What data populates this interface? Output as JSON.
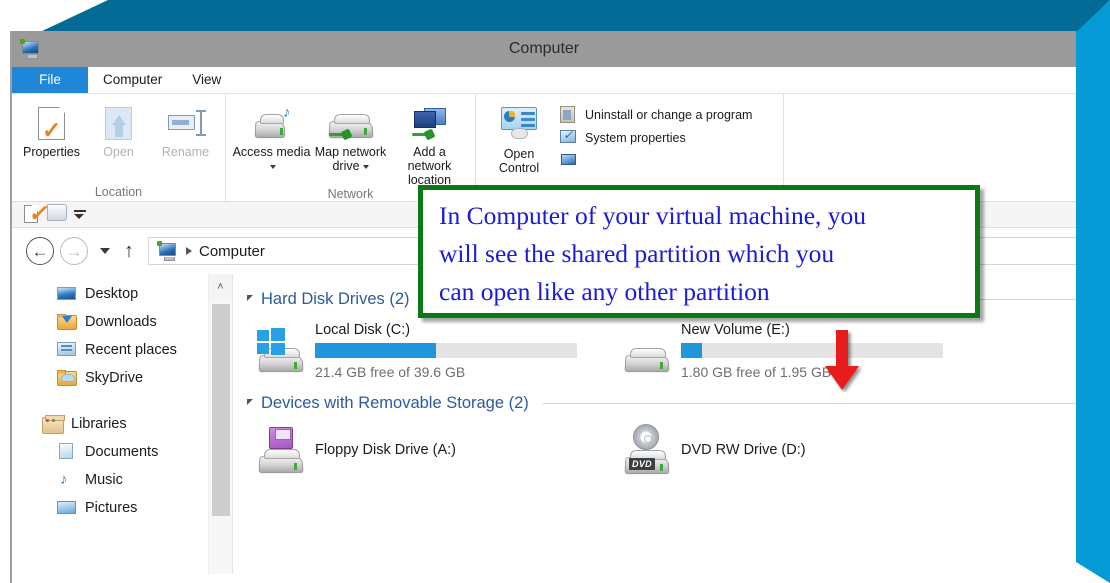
{
  "window": {
    "title": "Computer",
    "icon": "computer-icon"
  },
  "tabs": [
    {
      "label": "File",
      "type": "file"
    },
    {
      "label": "Computer",
      "type": "tab",
      "active": true
    },
    {
      "label": "View",
      "type": "tab",
      "active": false
    }
  ],
  "ribbon": {
    "groups": [
      {
        "label": "Location",
        "buttons": [
          {
            "label": "Properties",
            "icon": "properties-icon",
            "disabled": false,
            "dropdown": false
          },
          {
            "label": "Open",
            "icon": "open-icon",
            "disabled": true,
            "dropdown": false
          },
          {
            "label": "Rename",
            "icon": "rename-icon",
            "disabled": true,
            "dropdown": false
          }
        ]
      },
      {
        "label": "Network",
        "buttons": [
          {
            "label": "Access media",
            "icon": "access-media-icon",
            "disabled": false,
            "dropdown": true
          },
          {
            "label": "Map network drive",
            "icon": "map-network-drive-icon",
            "disabled": false,
            "dropdown": true
          },
          {
            "label": "Add a network location",
            "icon": "add-network-location-icon",
            "disabled": false,
            "dropdown": false
          }
        ]
      },
      {
        "label": "",
        "buttons": [
          {
            "label": "Open Control",
            "icon": "control-panel-icon",
            "disabled": false,
            "dropdown": false
          }
        ],
        "small_buttons": [
          {
            "label": "Uninstall or change a program",
            "icon": "uninstall-program-icon"
          },
          {
            "label": "System properties",
            "icon": "system-properties-icon"
          },
          {
            "label": "",
            "icon": "manage-icon"
          }
        ]
      }
    ]
  },
  "quick_access": {
    "items": [
      {
        "icon": "properties-small-icon"
      },
      {
        "icon": "folder-small-icon"
      },
      {
        "icon": "customize-dropdown-icon"
      }
    ]
  },
  "address_bar": {
    "back_label": "←",
    "forward_label": "→",
    "up_label": "↑",
    "crumb_icon": "computer-icon",
    "crumb": "Computer"
  },
  "nav_pane": {
    "groups": [
      {
        "items": [
          {
            "label": "Desktop",
            "icon": "desktop-icon"
          },
          {
            "label": "Downloads",
            "icon": "downloads-folder-icon"
          },
          {
            "label": "Recent places",
            "icon": "recent-places-icon"
          },
          {
            "label": "SkyDrive",
            "icon": "skydrive-icon"
          }
        ]
      },
      {
        "items": [
          {
            "label": "Libraries",
            "icon": "libraries-icon",
            "root": true
          },
          {
            "label": "Documents",
            "icon": "documents-icon"
          },
          {
            "label": "Music",
            "icon": "music-icon"
          },
          {
            "label": "Pictures",
            "icon": "pictures-icon"
          }
        ]
      }
    ]
  },
  "content": {
    "sections": [
      {
        "title": "Hard Disk Drives (2)",
        "kind": "drives",
        "drives": [
          {
            "name": "Local Disk (C:)",
            "icon": "windows-drive-icon",
            "used_percent": 46,
            "free_text": "21.4 GB free of 39.6 GB"
          },
          {
            "name": "New Volume (E:)",
            "icon": "drive-icon",
            "used_percent": 8,
            "free_text": "1.80 GB free of 1.95 GB"
          }
        ]
      },
      {
        "title": "Devices with Removable Storage (2)",
        "kind": "devices",
        "devices": [
          {
            "name": "Floppy Disk Drive (A:)",
            "icon": "floppy-drive-icon"
          },
          {
            "name": "DVD RW Drive (D:)",
            "icon": "dvd-drive-icon",
            "badge": "DVD"
          }
        ]
      }
    ]
  },
  "callout": {
    "lines": [
      "In Computer of your virtual machine, you",
      "will see the shared partition which you",
      "can open like any other partition"
    ],
    "border_color": "#0a7a16",
    "text_color": "#1a1ad8"
  },
  "arrow": {
    "name": "red-down-arrow",
    "color": "#e81a1a"
  },
  "colors": {
    "frame_top": "#046a96",
    "frame_right": "#039ad6",
    "titlebar": "#9a9a9a",
    "file_tab": "#1f86d8",
    "section_heading": "#2b5b9e",
    "meter_fill": "#2196dd"
  }
}
